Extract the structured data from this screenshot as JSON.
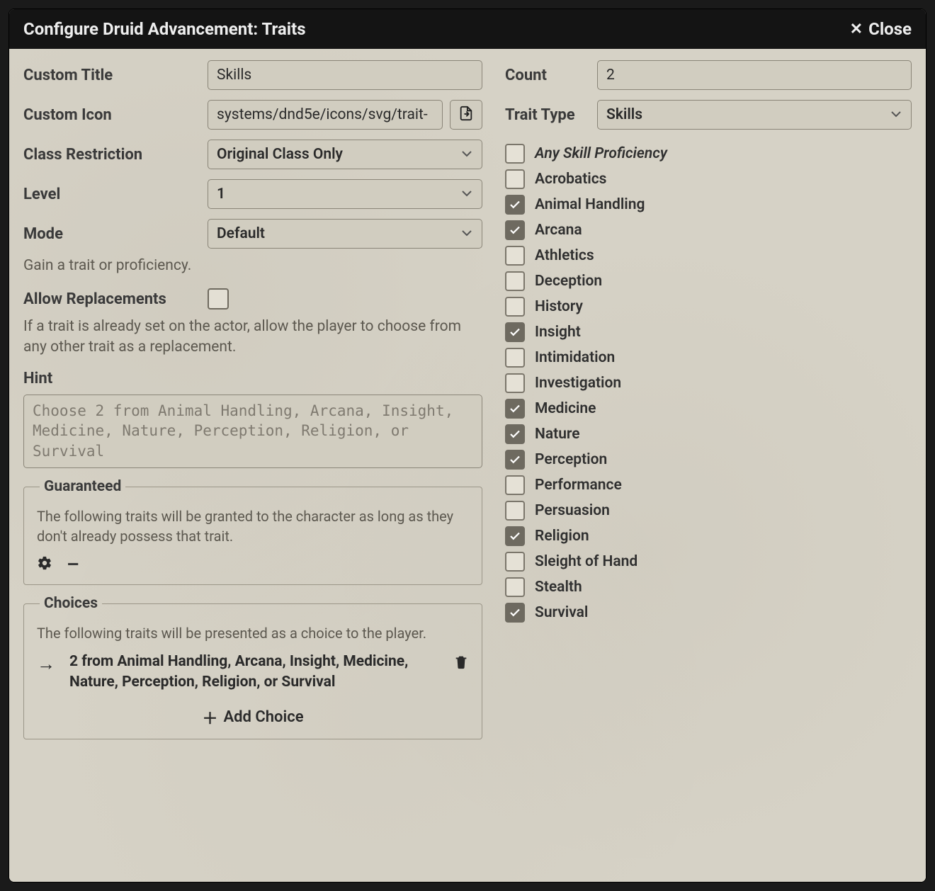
{
  "titlebar": {
    "title": "Configure Druid Advancement: Traits",
    "close": "Close"
  },
  "left": {
    "custom_title": {
      "label": "Custom Title",
      "value": "Skills"
    },
    "custom_icon": {
      "label": "Custom Icon",
      "value": "systems/dnd5e/icons/svg/trait-"
    },
    "class_restriction": {
      "label": "Class Restriction",
      "value": "Original Class Only"
    },
    "level": {
      "label": "Level",
      "value": "1"
    },
    "mode": {
      "label": "Mode",
      "value": "Default",
      "hint": "Gain a trait or proficiency."
    },
    "allow_replacements": {
      "label": "Allow Replacements",
      "hint": "If a trait is already set on the actor, allow the player to choose from any other trait as a replacement."
    },
    "hint_field": {
      "label": "Hint",
      "placeholder": "Choose 2 from Animal Handling, Arcana, Insight, Medicine, Nature, Perception, Religion, or Survival"
    },
    "guaranteed": {
      "legend": "Guaranteed",
      "desc": "The following traits will be granted to the character as long as they don't already possess that trait."
    },
    "choices": {
      "legend": "Choices",
      "desc": "The following traits will be presented as a choice to the player.",
      "item": "2 from Animal Handling, Arcana, Insight, Medicine, Nature, Perception, Religion, or Survival",
      "add": "Add Choice"
    }
  },
  "right": {
    "count": {
      "label": "Count",
      "value": "2"
    },
    "trait_type": {
      "label": "Trait Type",
      "value": "Skills"
    },
    "skills": [
      {
        "label": "Any Skill Proficiency",
        "checked": false,
        "italic": true
      },
      {
        "label": "Acrobatics",
        "checked": false
      },
      {
        "label": "Animal Handling",
        "checked": true
      },
      {
        "label": "Arcana",
        "checked": true
      },
      {
        "label": "Athletics",
        "checked": false
      },
      {
        "label": "Deception",
        "checked": false
      },
      {
        "label": "History",
        "checked": false
      },
      {
        "label": "Insight",
        "checked": true
      },
      {
        "label": "Intimidation",
        "checked": false
      },
      {
        "label": "Investigation",
        "checked": false
      },
      {
        "label": "Medicine",
        "checked": true
      },
      {
        "label": "Nature",
        "checked": true
      },
      {
        "label": "Perception",
        "checked": true
      },
      {
        "label": "Performance",
        "checked": false
      },
      {
        "label": "Persuasion",
        "checked": false
      },
      {
        "label": "Religion",
        "checked": true
      },
      {
        "label": "Sleight of Hand",
        "checked": false
      },
      {
        "label": "Stealth",
        "checked": false
      },
      {
        "label": "Survival",
        "checked": true
      }
    ]
  }
}
